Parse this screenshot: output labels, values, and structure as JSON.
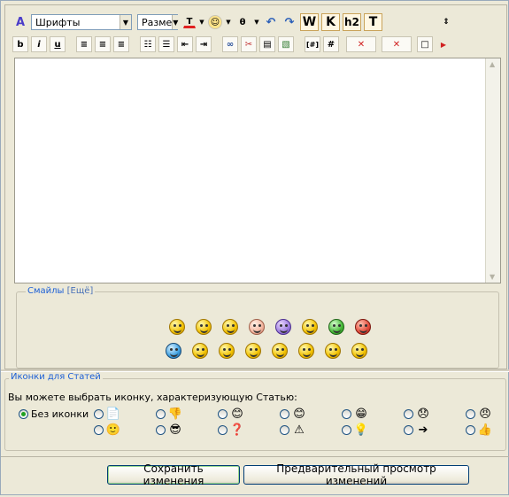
{
  "toolbar": {
    "font_select": "Шрифты",
    "size_select": "Разме",
    "big_buttons": [
      "W",
      "K",
      "h2",
      "T"
    ],
    "format_buttons": [
      "b",
      "i",
      "u"
    ],
    "special_buttons": [
      "[#]",
      "#"
    ]
  },
  "smilies": {
    "legend": "Смайлы",
    "more": "[Ещё]",
    "row1": [
      "yellow",
      "yellow",
      "yellow",
      "pink",
      "purple",
      "yellow",
      "green",
      "red"
    ],
    "row2": [
      "blue",
      "yellow",
      "yellow",
      "yellow",
      "yellow",
      "yellow",
      "yellow",
      "yellow"
    ]
  },
  "icons": {
    "legend": "Иконки для Статей",
    "description": "Вы можете выбрать иконку, характеризующую Статью:",
    "no_icon_label": "Без иконки",
    "glyphs_row1": [
      "📄",
      "👎",
      "😊",
      "😊",
      "😁",
      "😞",
      "😠"
    ],
    "glyphs_row2": [
      "🙂",
      "😎",
      "❓",
      "⚠",
      "💡",
      "➔",
      "👍"
    ]
  },
  "buttons": {
    "save": "Сохранить изменения",
    "preview": "Предварительный просмотр изменений"
  },
  "colors": {
    "accent_text": "#1c5fd6",
    "background": "#ece9d8"
  }
}
